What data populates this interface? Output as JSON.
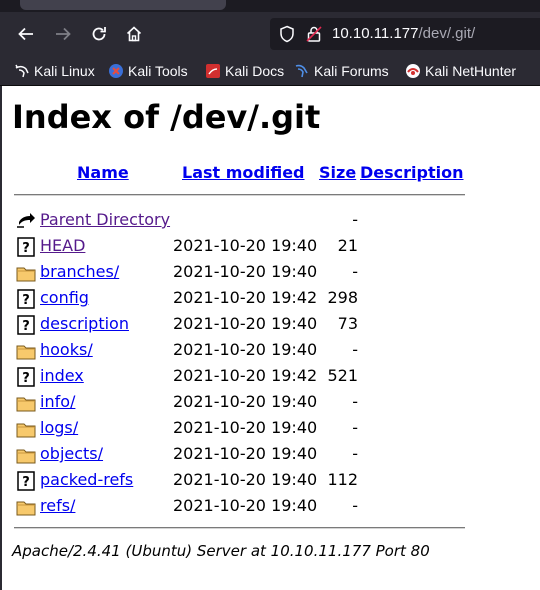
{
  "browser": {
    "url_host": "10.10.11.177",
    "url_path": "/dev/.git/",
    "bookmarks": [
      "Kali Linux",
      "Kali Tools",
      "Kali Docs",
      "Kali Forums",
      "Kali NetHunter"
    ]
  },
  "page": {
    "title": "Index of /dev/.git",
    "columns": {
      "name": "Name",
      "modified": "Last modified",
      "size": "Size",
      "description": "Description"
    },
    "entries": [
      {
        "name": "Parent Directory",
        "date": "",
        "size": "-",
        "type": "parent",
        "visited": true
      },
      {
        "name": "HEAD",
        "date": "2021-10-20 19:40",
        "size": "21",
        "type": "file",
        "visited": true
      },
      {
        "name": "branches/",
        "date": "2021-10-20 19:40",
        "size": "-",
        "type": "folder",
        "visited": false
      },
      {
        "name": "config",
        "date": "2021-10-20 19:42",
        "size": "298",
        "type": "file",
        "visited": false
      },
      {
        "name": "description",
        "date": "2021-10-20 19:40",
        "size": "73",
        "type": "file",
        "visited": false
      },
      {
        "name": "hooks/",
        "date": "2021-10-20 19:40",
        "size": "-",
        "type": "folder",
        "visited": false
      },
      {
        "name": "index",
        "date": "2021-10-20 19:42",
        "size": "521",
        "type": "file",
        "visited": false
      },
      {
        "name": "info/",
        "date": "2021-10-20 19:40",
        "size": "-",
        "type": "folder",
        "visited": false
      },
      {
        "name": "logs/",
        "date": "2021-10-20 19:40",
        "size": "-",
        "type": "folder",
        "visited": false
      },
      {
        "name": "objects/",
        "date": "2021-10-20 19:40",
        "size": "-",
        "type": "folder",
        "visited": false
      },
      {
        "name": "packed-refs",
        "date": "2021-10-20 19:40",
        "size": "112",
        "type": "file",
        "visited": false
      },
      {
        "name": "refs/",
        "date": "2021-10-20 19:40",
        "size": "-",
        "type": "folder",
        "visited": false
      }
    ],
    "address": "Apache/2.4.41 (Ubuntu) Server at 10.10.11.177 Port 80"
  }
}
